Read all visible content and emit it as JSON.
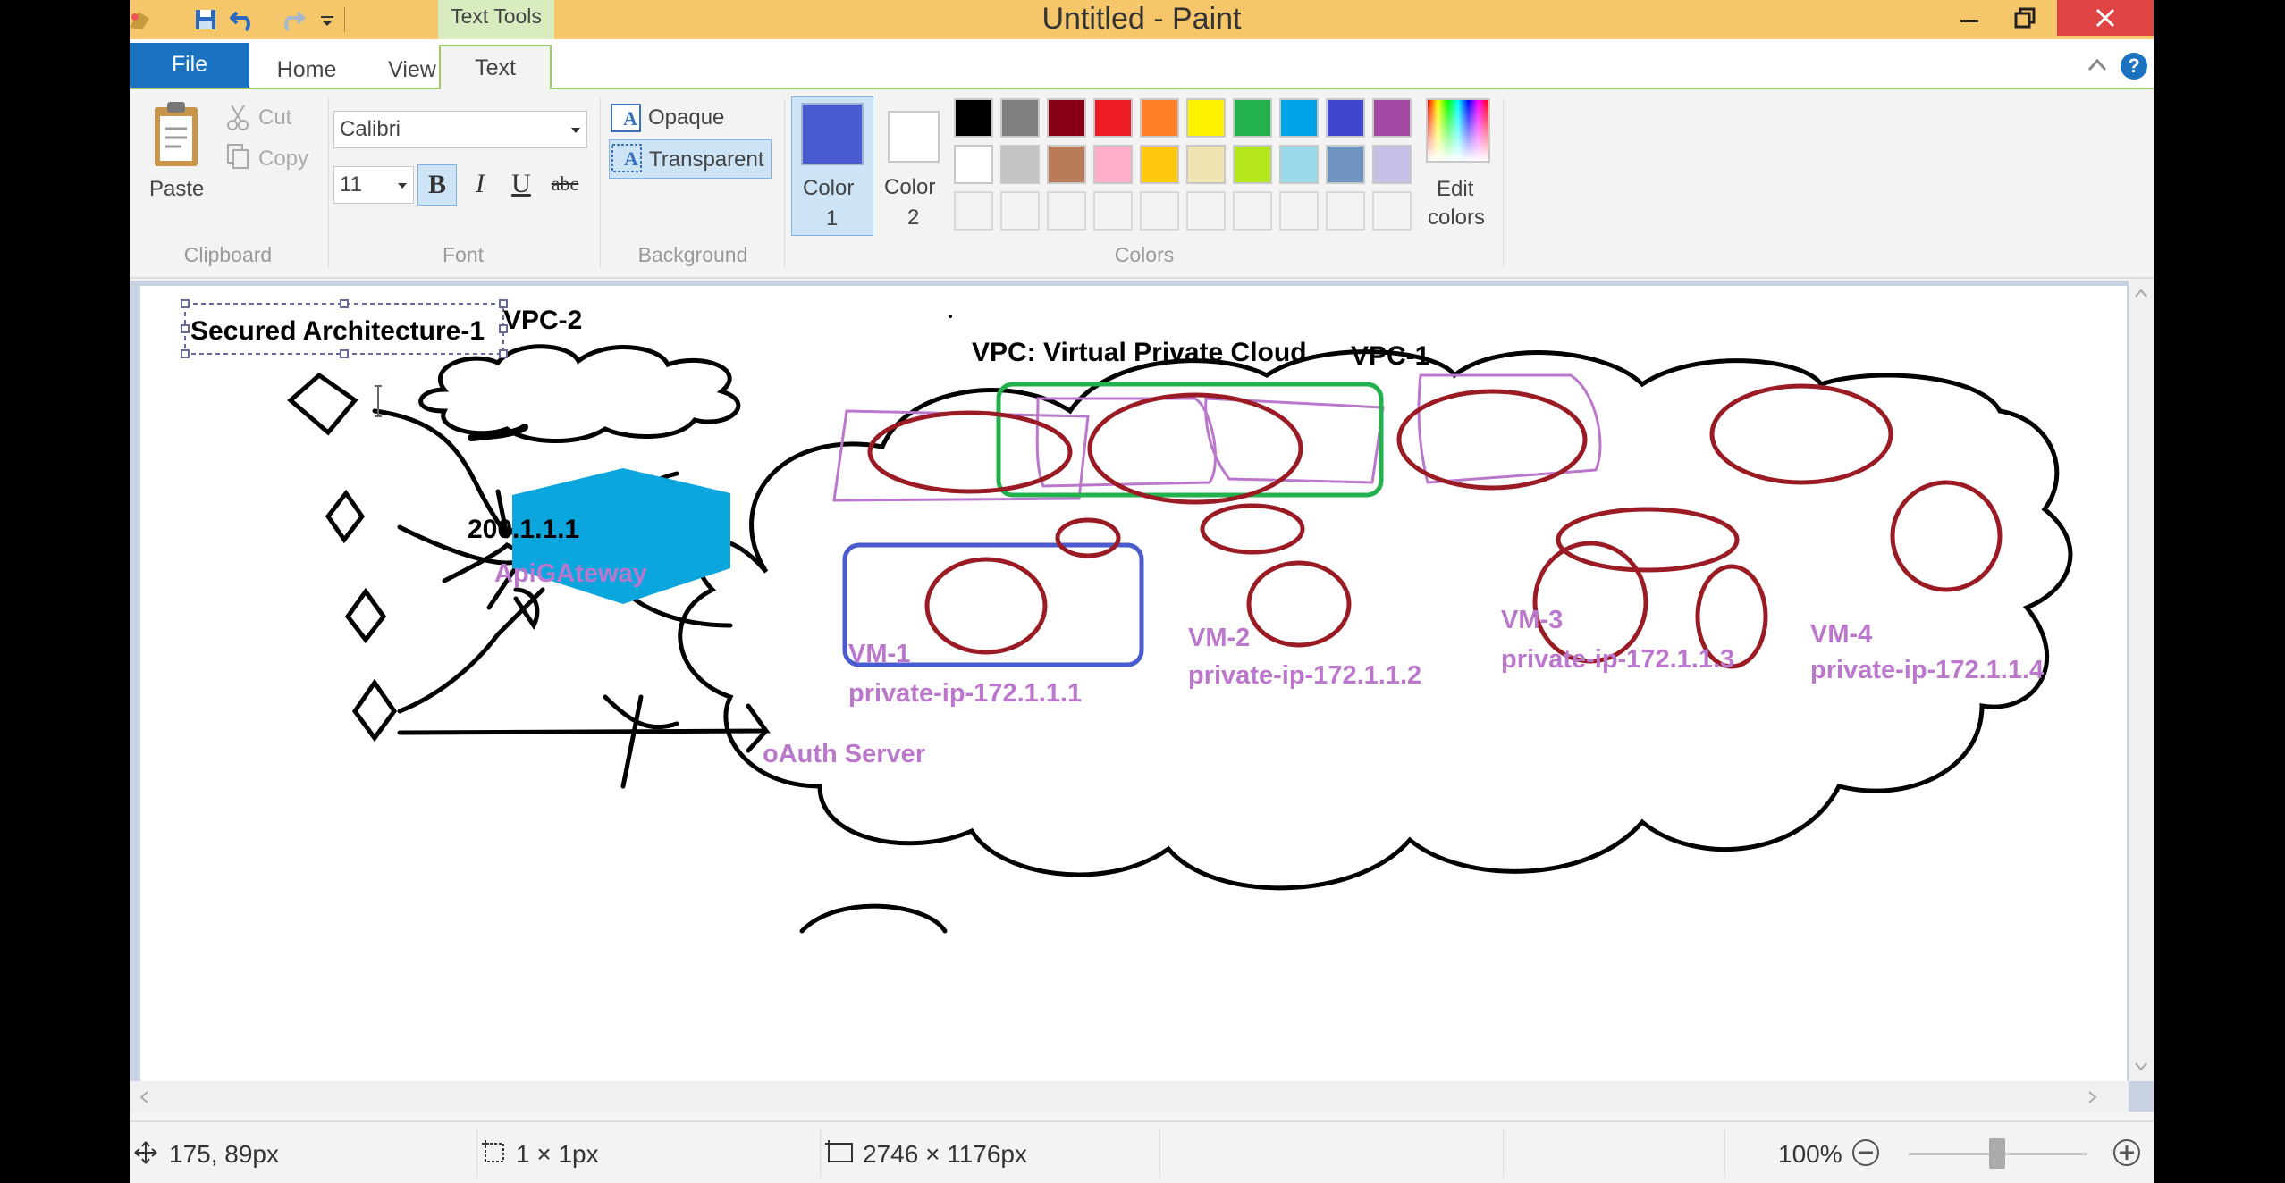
{
  "window": {
    "title": "Untitled - Paint",
    "context_tab": "Text Tools"
  },
  "tabs": {
    "file": "File",
    "home": "Home",
    "view": "View",
    "text": "Text"
  },
  "clipboard": {
    "paste": "Paste",
    "cut": "Cut",
    "copy": "Copy",
    "label": "Clipboard"
  },
  "font": {
    "family": "Calibri",
    "size": "11",
    "bold": "B",
    "italic": "I",
    "underline": "U",
    "strike": "abc",
    "label": "Font"
  },
  "background": {
    "opaque": "Opaque",
    "transparent": "Transparent",
    "label": "Background"
  },
  "colors": {
    "color1_label_a": "Color",
    "color1_label_b": "1",
    "color2_label_a": "Color",
    "color2_label_b": "2",
    "edit_a": "Edit",
    "edit_b": "colors",
    "label": "Colors",
    "color1": "#4a5bd0",
    "color2": "#ffffff",
    "palette_row1": [
      "#000000",
      "#7f7f7f",
      "#880015",
      "#ed1c24",
      "#ff7f27",
      "#fff200",
      "#22b14c",
      "#00a2e8",
      "#3f48cc",
      "#a349a4"
    ],
    "palette_row2": [
      "#ffffff",
      "#c3c3c3",
      "#b97a57",
      "#ffaec9",
      "#ffc90e",
      "#efe4b0",
      "#b5e61d",
      "#99d9ea",
      "#7092be",
      "#c8bfe7"
    ]
  },
  "canvas_text": {
    "title": "Secured Architecture-1",
    "vpc2": "VPC-2",
    "vpc_def": "VPC: Virtual Private Cloud",
    "vpc1": "VPC-1",
    "ip": "200.1.1.1",
    "gateway": "ApiGAteway",
    "vm1": "VM-1",
    "vm1_ip": "private-ip-172.1.1.1",
    "vm2": "VM-2",
    "vm2_ip": "private-ip-172.1.1.2",
    "vm3": "VM-3",
    "vm3_ip": "private-ip-172.1.1.3",
    "vm4": "VM-4",
    "vm4_ip": "private-ip-172.1.1.4",
    "oauth": "oAuth Server"
  },
  "status": {
    "cursor": "175, 89px",
    "selection": "1 × 1px",
    "canvas_size": "2746 × 1176px",
    "zoom": "100%"
  }
}
